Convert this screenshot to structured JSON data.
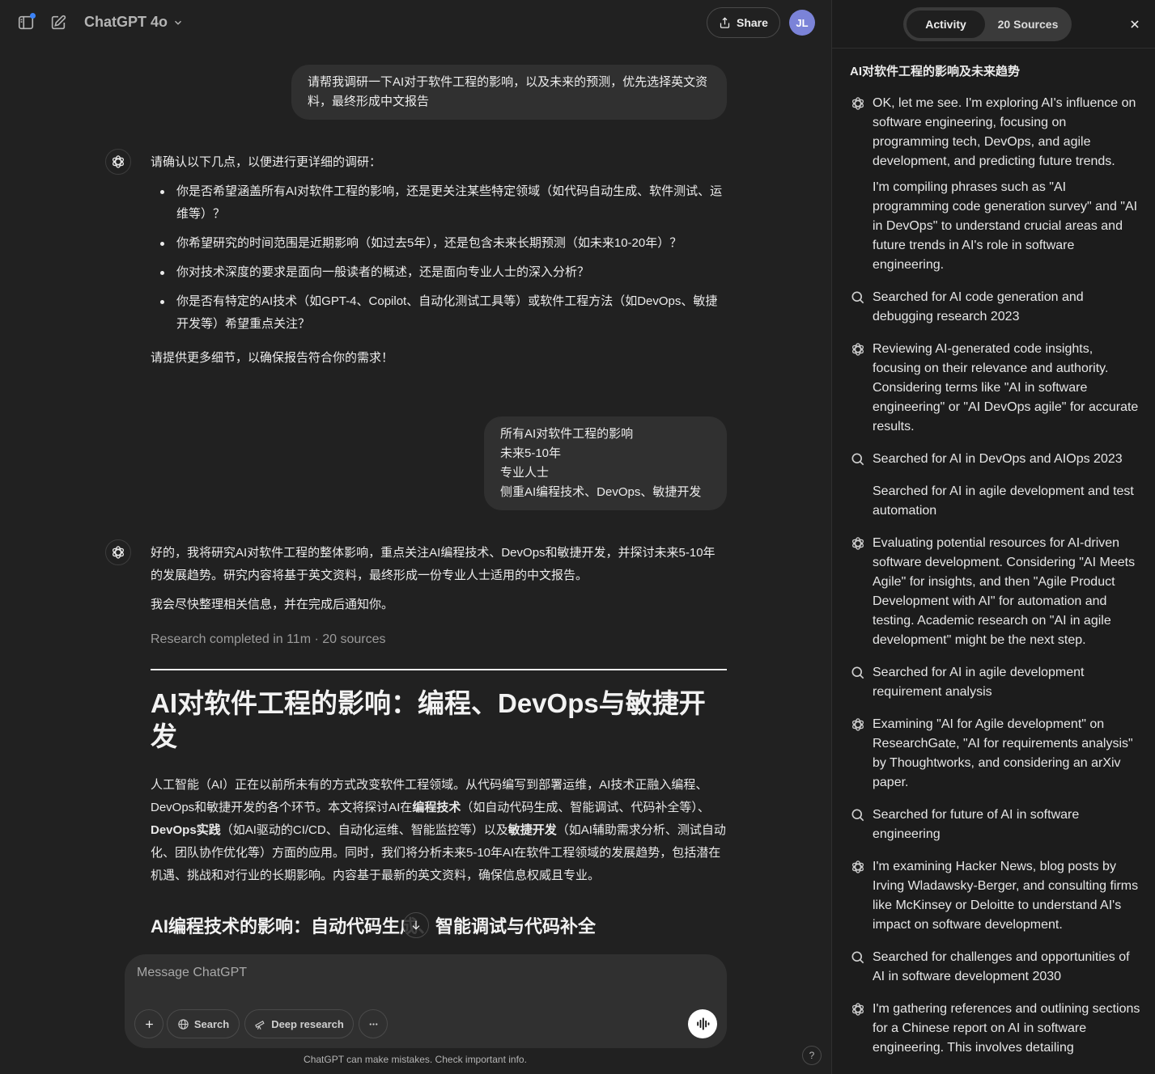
{
  "topbar": {
    "model_name": "ChatGPT 4o",
    "share_label": "Share",
    "avatar_initials": "JL"
  },
  "conversation": {
    "user_message_1": "请帮我调研一下AI对于软件工程的影响，以及未来的预测，优先选择英文资料，最终形成中文报告",
    "assistant_1": {
      "intro": "请确认以下几点，以便进行更详细的调研：",
      "questions": [
        "你是否希望涵盖所有AI对软件工程的影响，还是更关注某些特定领域（如代码自动生成、软件测试、运维等）？",
        "你希望研究的时间范围是近期影响（如过去5年），还是包含未来长期预测（如未来10-20年）？",
        "你对技术深度的要求是面向一般读者的概述，还是面向专业人士的深入分析？",
        "你是否有特定的AI技术（如GPT-4、Copilot、自动化测试工具等）或软件工程方法（如DevOps、敏捷开发等）希望重点关注？"
      ],
      "closing": "请提供更多细节，以确保报告符合你的需求！"
    },
    "user_message_2": {
      "lines": [
        "所有AI对软件工程的影响",
        "未来5-10年",
        "专业人士",
        "侧重AI编程技术、DevOps、敏捷开发"
      ]
    },
    "assistant_2": {
      "p1": "好的，我将研究AI对软件工程的整体影响，重点关注AI编程技术、DevOps和敏捷开发，并探讨未来5-10年的发展趋势。研究内容将基于英文资料，最终形成一份专业人士适用的中文报告。",
      "p2": "我会尽快整理相关信息，并在完成后通知你。",
      "research_meta": "Research completed in 11m · 20 sources"
    },
    "report": {
      "title": "AI对软件工程的影响：编程、DevOps与敏捷开发",
      "body_1": "人工智能（AI）正在以前所未有的方式改变软件工程领域。从代码编写到部署运维，AI技术正融入编程、DevOps和敏捷开发的各个环节。本文将探讨AI在",
      "bold_1": "编程技术",
      "body_2": "（如自动代码生成、智能调试、代码补全等）、",
      "bold_2": "DevOps实践",
      "body_3": "（如AI驱动的CI/CD、自动化运维、智能监控等）以及",
      "bold_3": "敏捷开发",
      "body_4": "（如AI辅助需求分析、测试自动化、团队协作优化等）方面的应用。同时，我们将分析未来5-10年AI在软件工程领域的发展趋势，包括潜在机遇、挑战和对行业的长期影响。内容基于最新的英文资料，确保信息权威且专业。",
      "section_heading": "AI编程技术的影响：自动代码生成、智能调试与代码补全"
    }
  },
  "composer": {
    "placeholder": "Message ChatGPT",
    "search_label": "Search",
    "deep_research_label": "Deep research",
    "disclaimer": "ChatGPT can make mistakes. Check important info.",
    "help_label": "?"
  },
  "panel": {
    "tab_activity": "Activity",
    "tab_sources": "20 Sources",
    "title": "AI对软件工程的影响及未来趋势",
    "activity": [
      {
        "icon": "openai-logo-icon",
        "paragraphs": [
          "OK, let me see. I'm exploring AI's influence on software engineering, focusing on programming tech, DevOps, and agile development, and predicting future trends.",
          "I'm compiling phrases such as \"AI programming code generation survey\" and \"AI in DevOps\" to understand crucial areas and future trends in AI's role in software engineering."
        ]
      },
      {
        "icon": "search-icon",
        "paragraphs": [
          "Searched for AI code generation and debugging research 2023"
        ]
      },
      {
        "icon": "openai-logo-icon",
        "paragraphs": [
          "Reviewing AI-generated code insights, focusing on their relevance and authority. Considering terms like \"AI in software engineering\" or \"AI DevOps agile\" for accurate results."
        ]
      },
      {
        "icon": "search-icon",
        "paragraphs": [
          "Searched for AI in DevOps and AIOps 2023"
        ]
      },
      {
        "icon": "none",
        "paragraphs": [
          "Searched for AI in agile development and test automation"
        ]
      },
      {
        "icon": "openai-logo-icon",
        "paragraphs": [
          "Evaluating potential resources for AI-driven software development. Considering \"AI Meets Agile\" for insights, and then \"Agile Product Development with AI\" for automation and testing. Academic research on \"AI in agile development\" might be the next step."
        ]
      },
      {
        "icon": "search-icon",
        "paragraphs": [
          "Searched for AI in agile development requirement analysis"
        ]
      },
      {
        "icon": "openai-logo-icon",
        "paragraphs": [
          "Examining \"AI for Agile development\" on ResearchGate, \"AI for requirements analysis\" by Thoughtworks, and considering an arXiv paper."
        ]
      },
      {
        "icon": "search-icon",
        "paragraphs": [
          "Searched for future of AI in software engineering"
        ]
      },
      {
        "icon": "openai-logo-icon",
        "paragraphs": [
          "I'm examining Hacker News, blog posts by Irving Wladawsky-Berger, and consulting firms like McKinsey or Deloitte to understand AI's impact on software development."
        ]
      },
      {
        "icon": "search-icon",
        "paragraphs": [
          "Searched for challenges and opportunities of AI in software development 2030"
        ]
      },
      {
        "icon": "openai-logo-icon",
        "paragraphs": [
          "I'm gathering references and outlining sections for a Chinese report on AI in software engineering. This involves detailing"
        ]
      }
    ]
  },
  "colors": {
    "main_bg": "#212121",
    "panel_bg": "#1c1c1c",
    "bubble_bg": "#303030",
    "avatar_bg": "#7b83d8",
    "accent_dot": "#3b82f6"
  }
}
